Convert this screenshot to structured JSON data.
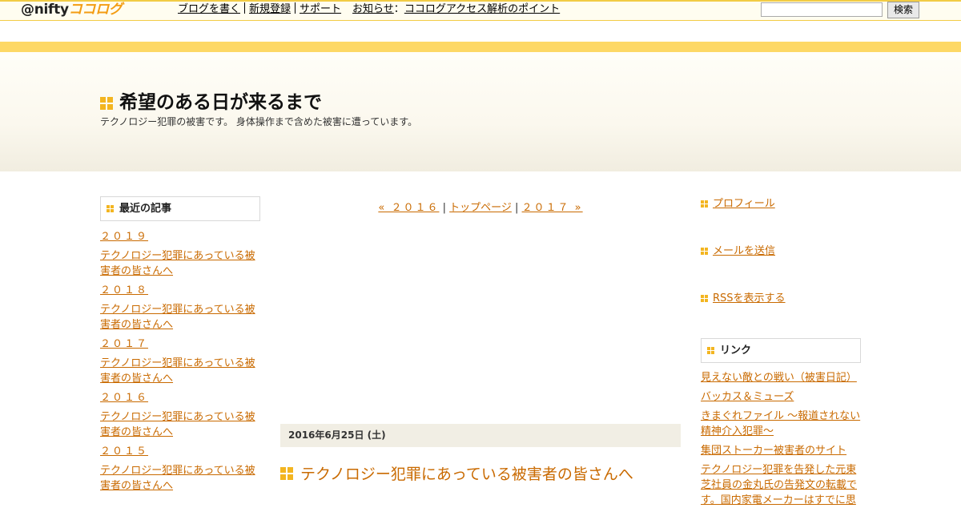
{
  "topbar": {
    "logo_at": "@nifty",
    "logo_brand": "ココログ",
    "nav": [
      "ブログを書く",
      "新規登録",
      "サポート"
    ],
    "notice_label": "お知らせ",
    "notice_sep": "：",
    "notice_link": "ココログアクセス解析のポイント",
    "search_value": "",
    "search_button": "検索"
  },
  "banner": {
    "title": "希望のある日が来るまで",
    "description": "テクノロジー犯罪の被害です。 身体操作まで含めた被害に遭っています。"
  },
  "recent": {
    "heading": "最近の記事",
    "items": [
      "２０１９",
      "テクノロジー犯罪にあっている被害者の皆さんへ",
      "２０１８",
      "テクノロジー犯罪にあっている被害者の皆さんへ",
      "２０１７",
      "テクノロジー犯罪にあっている被害者の皆さんへ",
      "２０１６",
      "テクノロジー犯罪にあっている被害者の皆さんへ",
      "２０１５",
      "テクノロジー犯罪にあっている被害者の皆さんへ"
    ]
  },
  "pager": {
    "prev": "« ２０１６",
    "sep": "|",
    "top": "トップページ",
    "next": "２０１７ »"
  },
  "entry": {
    "date": "2016年6月25日 (土)",
    "title": "テクノロジー犯罪にあっている被害者の皆さんへ"
  },
  "right": {
    "profile": "プロフィール",
    "mail": "メールを送信",
    "rss": "RSSを表示する",
    "links_heading": "リンク",
    "links": [
      "見えない敵との戦い（被害日記）",
      "バッカス＆ミューズ",
      "きまぐれファイル ～報道されない精神介入犯罪～",
      "集団ストーカー被害者のサイト",
      "テクノロジー犯罪を告発した元東芝社員の金丸氏の告発文の転載です。国内家電メーカーはすでに思"
    ]
  },
  "colors": {
    "accent": "#f3b520",
    "link": "#c96a00",
    "strip": "#fdd865"
  }
}
